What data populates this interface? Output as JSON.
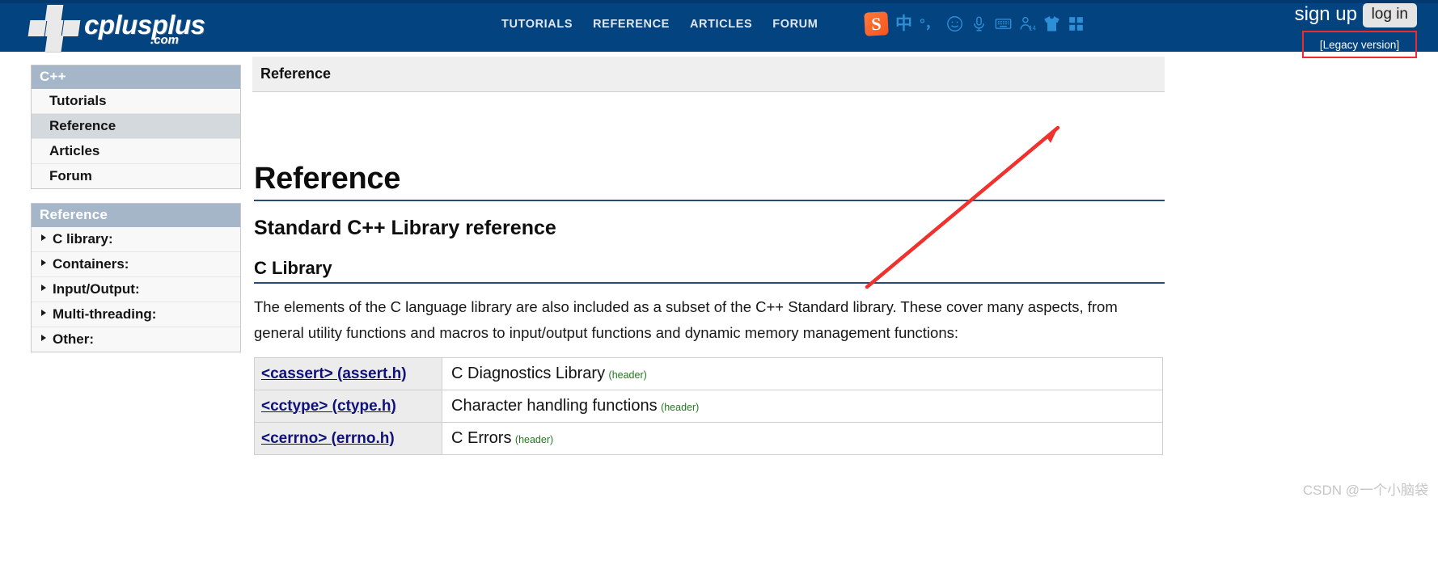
{
  "header": {
    "logo": {
      "name": "cplusplus",
      "suffix": ".com",
      "icon": "cplusplus-cross-logo"
    },
    "nav": [
      {
        "label": "TUTORIALS"
      },
      {
        "label": "REFERENCE"
      },
      {
        "label": "ARTICLES"
      },
      {
        "label": "FORUM"
      }
    ],
    "account": {
      "sign_up": "sign up",
      "log_in": "log in",
      "legacy": "[Legacy version]"
    },
    "ime": {
      "app": "S",
      "mode": "中",
      "punctuation": "°，",
      "icons": [
        "sogou-logo-icon",
        "chinese-mode-icon",
        "punctuation-icon",
        "emoji-icon",
        "microphone-icon",
        "soft-keyboard-icon",
        "user-14-icon",
        "skin-tshirt-icon",
        "toolbox-grid-icon"
      ]
    },
    "colors": {
      "bar": "#024380",
      "accent_red": "#ef2b2b"
    }
  },
  "sidebar": {
    "blocks": [
      {
        "title": "C++",
        "items": [
          {
            "label": "Tutorials",
            "active": false
          },
          {
            "label": "Reference",
            "active": true
          },
          {
            "label": "Articles",
            "active": false
          },
          {
            "label": "Forum",
            "active": false
          }
        ]
      },
      {
        "title": "Reference",
        "items": [
          {
            "label": "C library:"
          },
          {
            "label": "Containers:"
          },
          {
            "label": "Input/Output:"
          },
          {
            "label": "Multi-threading:"
          },
          {
            "label": "Other:"
          }
        ]
      }
    ]
  },
  "main": {
    "breadcrumb": "Reference",
    "page_title": "Reference",
    "section_title": "Standard C++ Library reference",
    "subsection_title": "C Library",
    "intro": "The elements of the C language library are also included as a subset of the C++ Standard library. These cover many aspects, from general utility functions and macros to input/output functions and dynamic memory management functions:",
    "headers_table": {
      "rows": [
        {
          "name": "<cassert> (assert.h)",
          "description": "C Diagnostics Library",
          "tag": "(header)"
        },
        {
          "name": "<cctype> (ctype.h)",
          "description": "Character handling functions",
          "tag": "(header)"
        },
        {
          "name": "<cerrno> (errno.h)",
          "description": "C Errors",
          "tag": "(header)"
        }
      ]
    }
  },
  "annotations": {
    "arrow": {
      "name": "red-pointer-arrow",
      "color": "#ef2b2b"
    },
    "watermark": "CSDN @一个小脑袋"
  }
}
